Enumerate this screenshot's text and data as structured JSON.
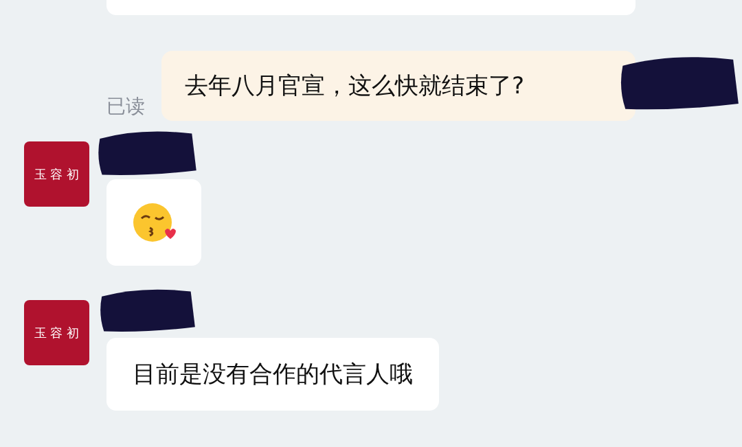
{
  "messages": [
    {
      "kind": "cut_bubble"
    },
    {
      "kind": "sent_text",
      "text": "去年八月官宣，这么快就结束了?",
      "read_label": "已读"
    },
    {
      "kind": "received_emoji",
      "avatar": "玉 容 初"
    },
    {
      "kind": "received_text",
      "avatar": "玉 容 初",
      "text": "目前是没有合作的代言人哦"
    }
  ]
}
